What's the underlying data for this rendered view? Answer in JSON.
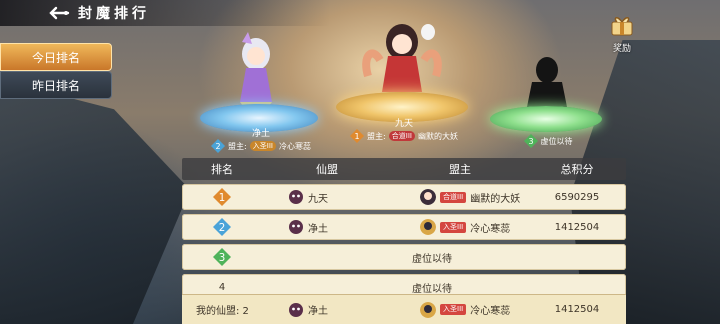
{
  "header": {
    "title": "封魔排行"
  },
  "tabs": [
    {
      "label": "今日排名",
      "active": true
    },
    {
      "label": "昨日排名",
      "active": false
    }
  ],
  "reward": {
    "label": "奖励"
  },
  "podium": {
    "first": {
      "rank": "1",
      "guild": "九天",
      "lord_prefix": "盟主:",
      "lord_tag": "合道III",
      "lord_name": "幽默的大妖"
    },
    "second": {
      "rank": "2",
      "guild": "净土",
      "lord_prefix": "盟主:",
      "lord_tag": "入圣III",
      "lord_name": "冷心寒蕊"
    },
    "third": {
      "rank": "3",
      "text": "虚位以待"
    }
  },
  "table": {
    "headers": [
      "排名",
      "仙盟",
      "盟主",
      "总积分"
    ],
    "rows": [
      {
        "rank": "1",
        "guild": "九天",
        "tag": "合道III",
        "lord": "幽默的大妖",
        "score": "6590295"
      },
      {
        "rank": "2",
        "guild": "净土",
        "tag": "入圣III",
        "lord": "冷心寒蕊",
        "score": "1412504"
      },
      {
        "rank": "3",
        "vacant": "虚位以待"
      },
      {
        "rank": "4",
        "vacant": "虚位以待"
      }
    ]
  },
  "my_guild": {
    "label": "我的仙盟: 2",
    "guild": "净土",
    "tag": "入圣III",
    "lord": "冷心寒蕊",
    "score": "1412504"
  },
  "colors": {
    "gold": "#f0b85a",
    "row_bg": "#f6efd9",
    "badge_first": "#e08a2e",
    "badge_second": "#4aa3d8",
    "badge_third": "#4fb35a"
  }
}
